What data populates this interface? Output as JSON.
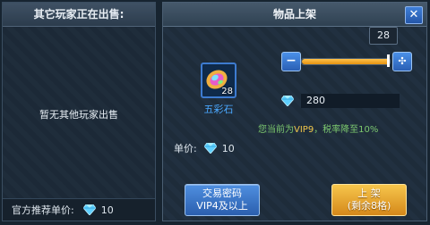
{
  "left_panel": {
    "title": "其它玩家正在出售:",
    "empty_message": "暂无其他玩家出售",
    "recommended_label": "官方推荐单价:",
    "recommended_price": "10"
  },
  "right_panel": {
    "title": "物品上架",
    "close_label": "✕",
    "item": {
      "name": "五彩石",
      "count": "28"
    },
    "quantity": {
      "value": "28",
      "fraction": 1.0
    },
    "total_price": "280",
    "vip_note_prefix": "您当前为",
    "vip_level": "VIP9",
    "vip_note_suffix": "，税率降至10%",
    "unit_price_label": "单价:",
    "unit_price": "10",
    "trade_button": {
      "line1": "交易密码",
      "line2": "VIP4及以上"
    },
    "list_button": {
      "line1": "上 架",
      "line2": "(剩余8格)"
    }
  },
  "colors": {
    "accent_blue": "#3d7bd0",
    "accent_orange": "#e49212",
    "vip_green": "#7cc86e",
    "diamond": "#5fd0ff"
  },
  "icons": {
    "currency": "diamond-icon",
    "close": "close-icon",
    "minus": "minus-icon",
    "plus": "plus-move-icon",
    "item": "five-color-stone-icon"
  }
}
